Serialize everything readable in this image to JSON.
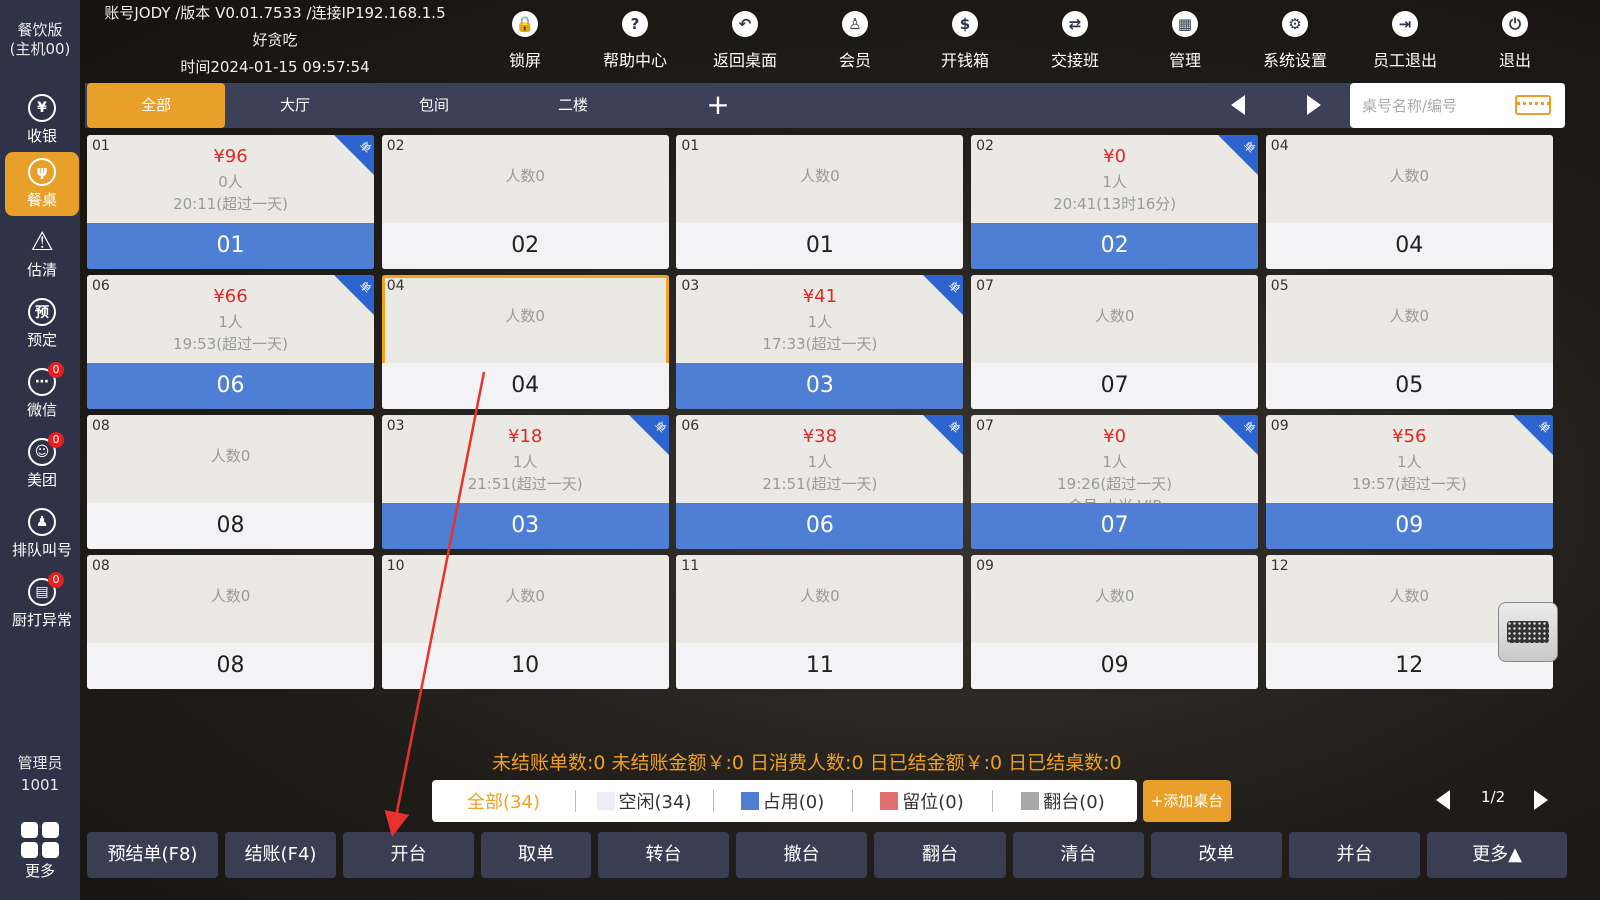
{
  "sidebar": {
    "top_label": "餐饮版\n(主机00)",
    "items": [
      {
        "label": "收银",
        "icon": "¥",
        "badge": null
      },
      {
        "label": "餐桌",
        "icon": "ψ",
        "badge": null
      },
      {
        "label": "估清",
        "icon": "⚠",
        "badge": null
      },
      {
        "label": "预定",
        "icon": "预",
        "badge": null
      },
      {
        "label": "微信",
        "icon": "⋯",
        "badge": "0"
      },
      {
        "label": "美团",
        "icon": "☺",
        "badge": "0"
      },
      {
        "label": "排队叫号",
        "icon": "♟",
        "badge": null
      },
      {
        "label": "厨打异常",
        "icon": "▤",
        "badge": "0"
      }
    ],
    "user_role": "管理员",
    "user_id": "1001",
    "more_label": "更多"
  },
  "header": {
    "account_line": "账号JODY /版本 V0.01.7533 /连接IP192.168.1.5",
    "store_name": "好贪吃",
    "time_line": "时间2024-01-15 09:57:54"
  },
  "toolbar": [
    {
      "label": "锁屏",
      "icon": "lock-icon",
      "glyph": "🔒"
    },
    {
      "label": "帮助中心",
      "icon": "help-icon",
      "glyph": "?"
    },
    {
      "label": "返回桌面",
      "icon": "back-icon",
      "glyph": "↶"
    },
    {
      "label": "会员",
      "icon": "member-icon",
      "glyph": "♙"
    },
    {
      "label": "开钱箱",
      "icon": "moneybag-icon",
      "glyph": "$"
    },
    {
      "label": "交接班",
      "icon": "handover-icon",
      "glyph": "⇄"
    },
    {
      "label": "管理",
      "icon": "manage-icon",
      "glyph": "▦"
    },
    {
      "label": "系统设置",
      "icon": "gear-icon",
      "glyph": "⚙"
    },
    {
      "label": "员工退出",
      "icon": "logout-icon",
      "glyph": "⇥"
    },
    {
      "label": "退出",
      "icon": "power-icon",
      "glyph": "⏻"
    }
  ],
  "area_tabs": [
    "全部",
    "大厅",
    "包间",
    "二楼"
  ],
  "search": {
    "placeholder": "桌号名称/编号"
  },
  "tables": [
    {
      "no": "01",
      "amount": "¥96",
      "lines": [
        "0人",
        "20:11(超过一天)"
      ],
      "name": "01",
      "occupied": true,
      "corner": "单"
    },
    {
      "no": "02",
      "amount": "",
      "lines": [
        "人数0"
      ],
      "name": "02",
      "occupied": false,
      "corner": ""
    },
    {
      "no": "01",
      "amount": "",
      "lines": [
        "人数0"
      ],
      "name": "01",
      "occupied": false,
      "corner": ""
    },
    {
      "no": "02",
      "amount": "¥0",
      "lines": [
        "1人",
        "20:41(13时16分)"
      ],
      "name": "02",
      "occupied": true,
      "corner": "单"
    },
    {
      "no": "04",
      "amount": "",
      "lines": [
        "人数0"
      ],
      "name": "04",
      "occupied": false,
      "corner": ""
    },
    {
      "no": "06",
      "amount": "¥66",
      "lines": [
        "1人",
        "19:53(超过一天)"
      ],
      "name": "06",
      "occupied": true,
      "corner": "单"
    },
    {
      "no": "04",
      "amount": "",
      "lines": [
        "人数0"
      ],
      "name": "04",
      "occupied": false,
      "corner": "",
      "selected": true
    },
    {
      "no": "03",
      "amount": "¥41",
      "lines": [
        "1人",
        "17:33(超过一天)"
      ],
      "name": "03",
      "occupied": true,
      "corner": "单"
    },
    {
      "no": "07",
      "amount": "",
      "lines": [
        "人数0"
      ],
      "name": "07",
      "occupied": false,
      "corner": ""
    },
    {
      "no": "05",
      "amount": "",
      "lines": [
        "人数0"
      ],
      "name": "05",
      "occupied": false,
      "corner": ""
    },
    {
      "no": "08",
      "amount": "",
      "lines": [
        "人数0"
      ],
      "name": "08",
      "occupied": false,
      "corner": ""
    },
    {
      "no": "03",
      "amount": "¥18",
      "lines": [
        "1人",
        "21:51(超过一天)"
      ],
      "name": "03",
      "occupied": true,
      "corner": "单"
    },
    {
      "no": "06",
      "amount": "¥38",
      "lines": [
        "1人",
        "21:51(超过一天)"
      ],
      "name": "06",
      "occupied": true,
      "corner": "单"
    },
    {
      "no": "07",
      "amount": "¥0",
      "lines": [
        "1人",
        "19:26(超过一天)",
        "会员:小米 VIP"
      ],
      "name": "07",
      "occupied": true,
      "corner": "单"
    },
    {
      "no": "09",
      "amount": "¥56",
      "lines": [
        "1人",
        "19:57(超过一天)"
      ],
      "name": "09",
      "occupied": true,
      "corner": "单"
    },
    {
      "no": "08",
      "amount": "",
      "lines": [
        "人数0"
      ],
      "name": "08",
      "occupied": false,
      "corner": ""
    },
    {
      "no": "10",
      "amount": "",
      "lines": [
        "人数0"
      ],
      "name": "10",
      "occupied": false,
      "corner": ""
    },
    {
      "no": "11",
      "amount": "",
      "lines": [
        "人数0"
      ],
      "name": "11",
      "occupied": false,
      "corner": ""
    },
    {
      "no": "09",
      "amount": "",
      "lines": [
        "人数0"
      ],
      "name": "09",
      "occupied": false,
      "corner": ""
    },
    {
      "no": "12",
      "amount": "",
      "lines": [
        "人数0"
      ],
      "name": "12",
      "occupied": false,
      "corner": ""
    }
  ],
  "summary": "未结账单数:0  未结账金额￥:0   日消费人数:0  日已结金额￥:0  日已结桌数:0",
  "filters": [
    {
      "label": "全部(34)",
      "swatch": null
    },
    {
      "label": "空闲(34)",
      "swatch": "#eceef5"
    },
    {
      "label": "占用(0)",
      "swatch": "#4f7fd4"
    },
    {
      "label": "留位(0)",
      "swatch": "#e07070"
    },
    {
      "label": "翻台(0)",
      "swatch": "#a8a8a8"
    }
  ],
  "add_table_label": "+添加桌台",
  "pager": {
    "text": "1/2"
  },
  "bottom_buttons": [
    "预结单(F8)",
    "结账(F4)",
    "开台",
    "取单",
    "转台",
    "撤台",
    "翻台",
    "清台",
    "改单",
    "并台",
    "更多▲"
  ],
  "colors": {
    "accent": "#e9a02b",
    "occupied": "#4f7fd4",
    "amount": "#e0282a",
    "sidebar": "#2f3347",
    "annotation_arrow": "#e8322e"
  }
}
